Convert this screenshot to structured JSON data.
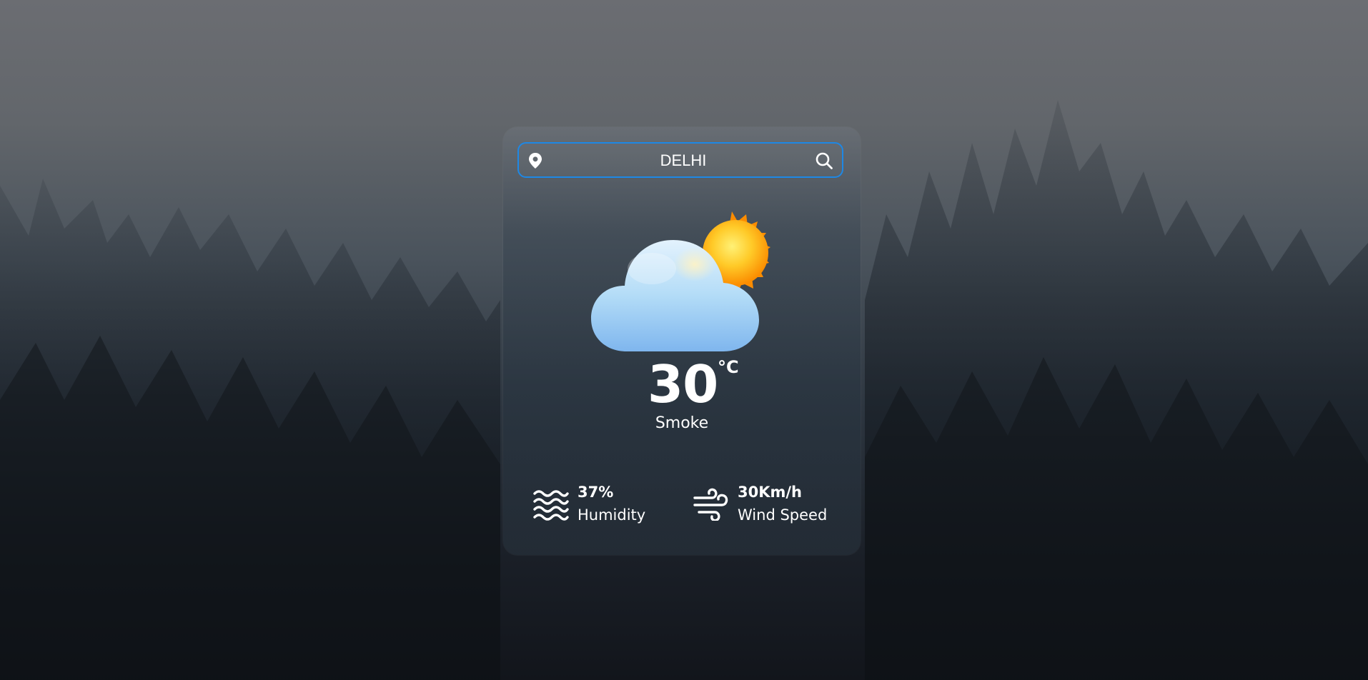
{
  "background": {
    "description_colors": {
      "fog_top": "#6b6d72",
      "forest_bottom": "#12151b"
    }
  },
  "search": {
    "value": "DELHI",
    "location_icon": "map-pin-icon",
    "search_icon": "search-icon",
    "border_color": "#1e88e5"
  },
  "weather": {
    "icon": "sun-behind-cloud-icon",
    "temperature": "30",
    "unit": "°C",
    "description": "Smoke"
  },
  "stats": {
    "humidity": {
      "icon": "waves-icon",
      "value": "37%",
      "label": "Humidity"
    },
    "wind": {
      "icon": "wind-icon",
      "value": "30Km/h",
      "label": "Wind Speed"
    }
  }
}
